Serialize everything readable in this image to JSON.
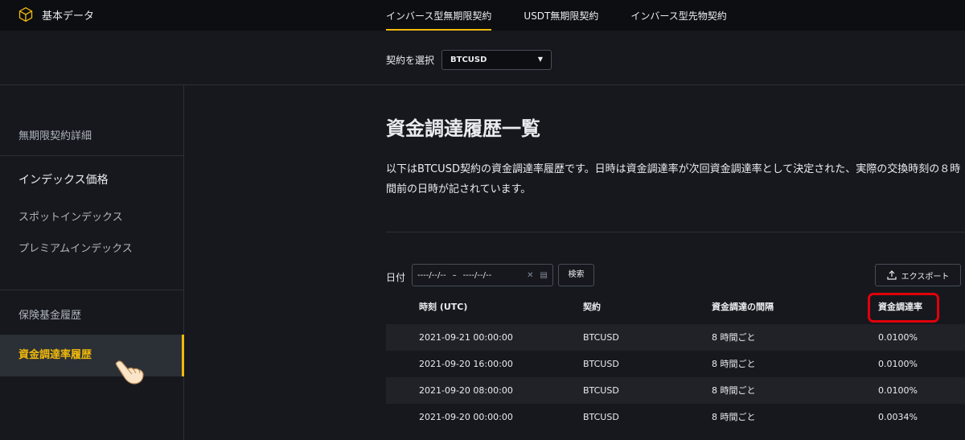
{
  "header": {
    "brand": "基本データ",
    "tabs": [
      "インバース型無期限契約",
      "USDT無期限契約",
      "インバース型先物契約"
    ]
  },
  "contract_select": {
    "label": "契約を選択",
    "value": "BTCUSD"
  },
  "sidebar": {
    "items": [
      {
        "label": "無期限契約詳細"
      },
      {
        "label": "インデックス価格"
      },
      {
        "label": "スポットインデックス"
      },
      {
        "label": "プレミアムインデックス"
      },
      {
        "label": "保険基金履歴"
      },
      {
        "label": "資金調達率履歴"
      }
    ]
  },
  "main": {
    "title": "資金調達履歴一覧",
    "description": "以下はBTCUSD契約の資金調達率履歴です。日時は資金調達率が次回資金調達率として決定された、実際の交換時刻の８時間前の日時が記されています。",
    "date_label": "日付",
    "date_from": "----/--/--",
    "date_to": "----/--/--",
    "search_label": "検索",
    "export_label": "エクスポート",
    "columns": [
      "時刻 (UTC)",
      "契約",
      "資金調達の間隔",
      "資金調達率"
    ],
    "rows": [
      [
        "2021-09-21 00:00:00",
        "BTCUSD",
        "8 時間ごと",
        "0.0100%"
      ],
      [
        "2021-09-20 16:00:00",
        "BTCUSD",
        "8 時間ごと",
        "0.0100%"
      ],
      [
        "2021-09-20 08:00:00",
        "BTCUSD",
        "8 時間ごと",
        "0.0100%"
      ],
      [
        "2021-09-20 00:00:00",
        "BTCUSD",
        "8 時間ごと",
        "0.0034%"
      ]
    ]
  },
  "colors": {
    "accent": "#f0b90b",
    "highlight": "#e0000a",
    "background": "#17181e"
  }
}
